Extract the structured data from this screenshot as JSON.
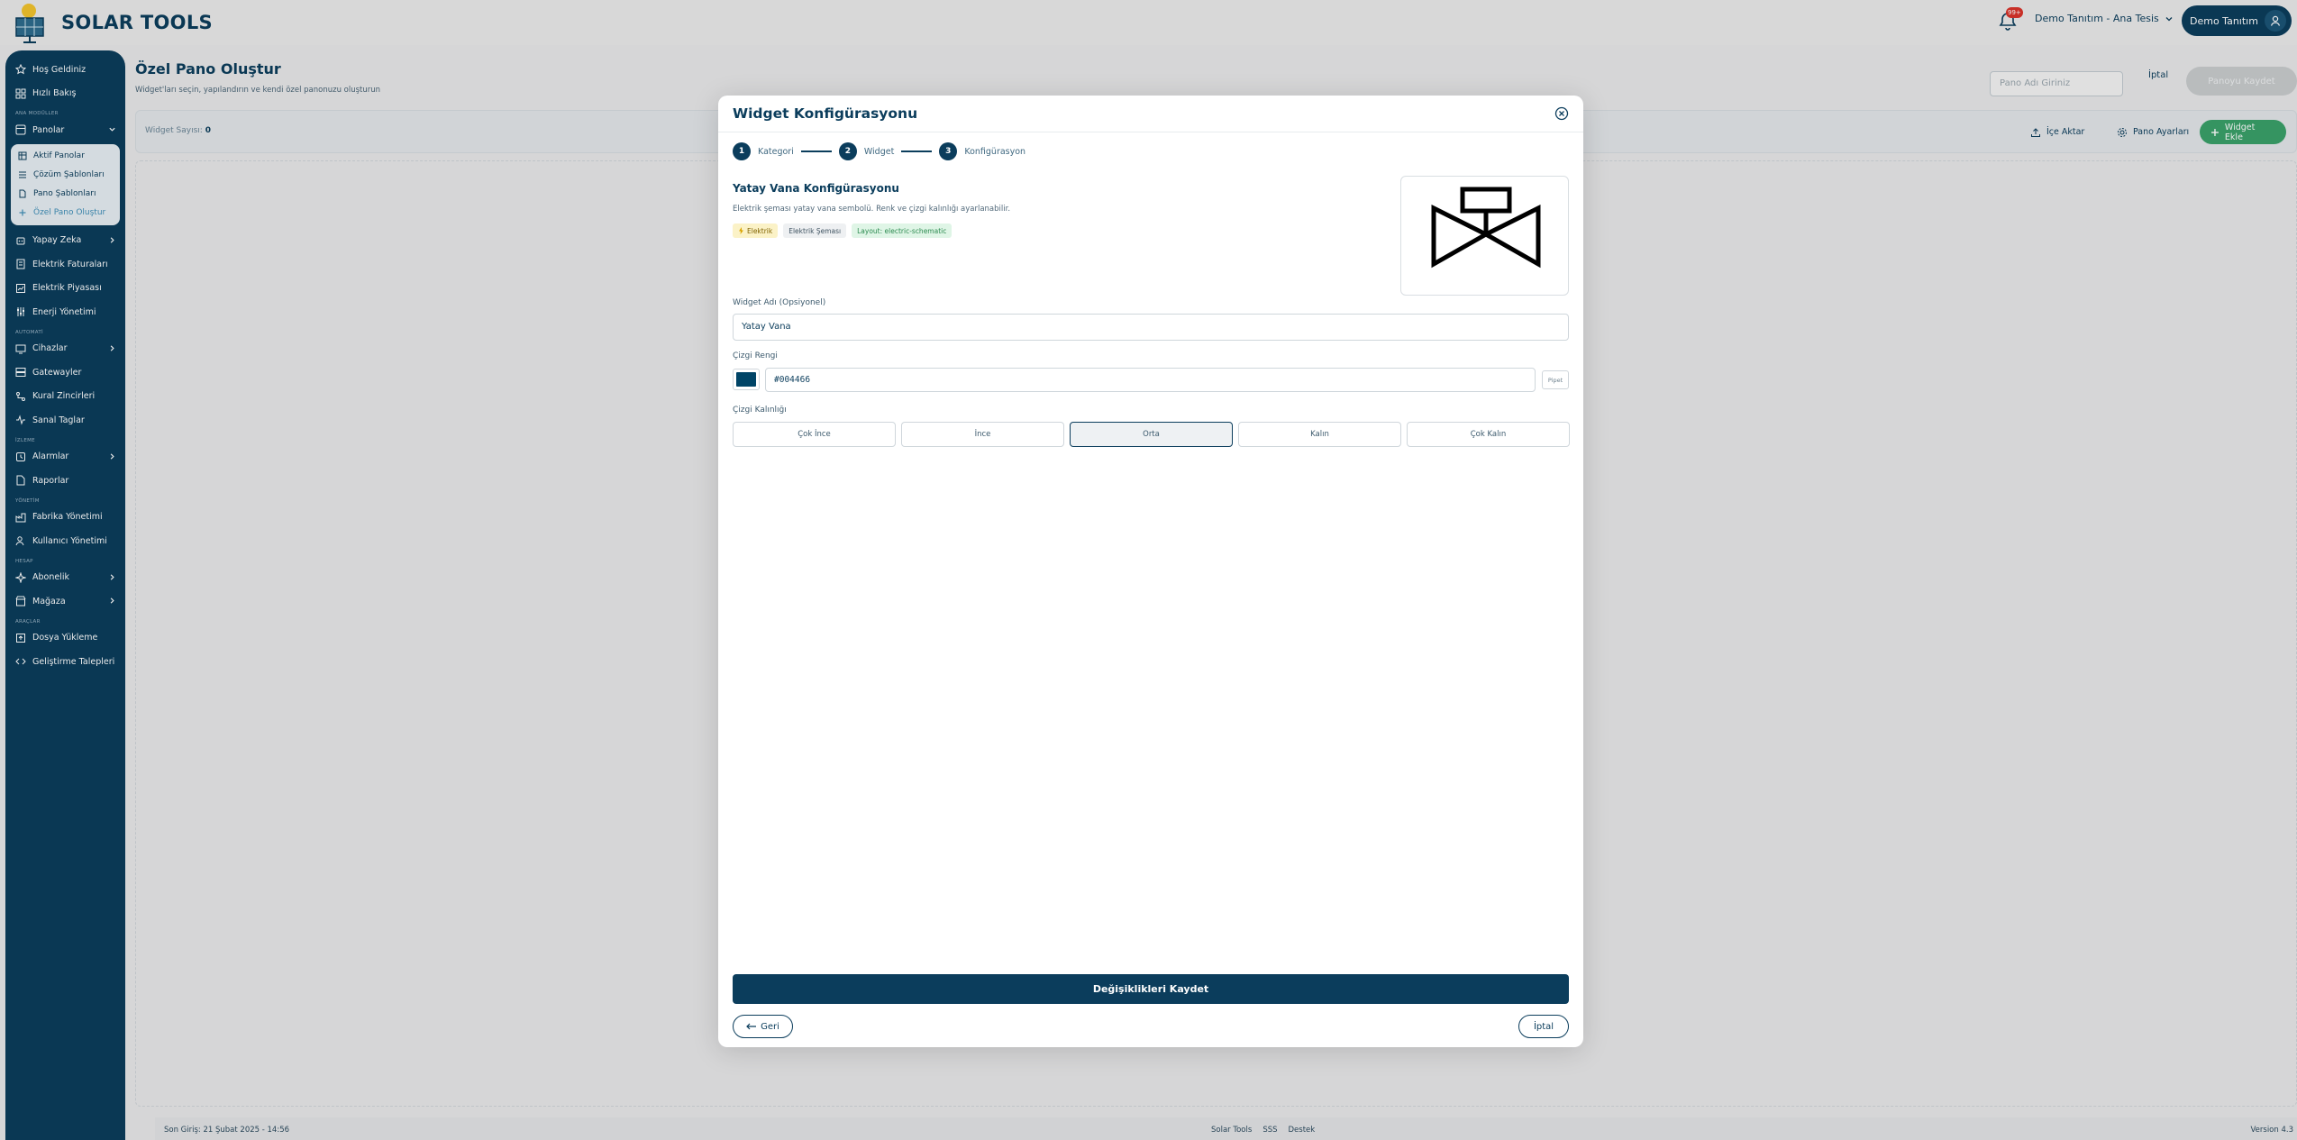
{
  "app": {
    "brand": "SOLAR TOOLS"
  },
  "header": {
    "notification_count": "99+",
    "facility": "Demo Tanıtım - Ana Tesis",
    "user_name": "Demo Tanıtım"
  },
  "sidebar": {
    "welcome": "Hoş Geldiniz",
    "quick_view": "Hızlı Bakış",
    "sec_main": "ANA MODÜLLER",
    "panels": "Panolar",
    "panels_sub": [
      "Aktif Panolar",
      "Çözüm Şablonları",
      "Pano Şablonları",
      "Özel Pano Oluştur"
    ],
    "ai": "Yapay Zeka",
    "invoices": "Elektrik Faturaları",
    "market": "Elektrik Piyasası",
    "energy": "Enerji Yönetimi",
    "sec_auto": "AUTOMATİ",
    "devices": "Cihazlar",
    "gateways": "Gatewayler",
    "rule_chains": "Kural Zincirleri",
    "virtual_tags": "Sanal Taglar",
    "sec_alarm": "İZLEME",
    "alarms": "Alarmlar",
    "reports": "Raporlar",
    "sec_admin": "YÖNETİM",
    "factory_mgmt": "Fabrika Yönetimi",
    "user_mgmt": "Kullanıcı Yönetimi",
    "sec_account": "HESAP",
    "subscription": "Abonelik",
    "store": "Mağaza",
    "sec_tools": "ARAÇLAR",
    "file_upload": "Dosya Yükleme",
    "dev_requests": "Geliştirme Talepleri"
  },
  "page": {
    "title": "Özel Pano Oluştur",
    "subtitle": "Widget'ları seçin, yapılandırın ve kendi özel panonuzu oluşturun",
    "board_name_placeholder": "Pano Adı Giriniz",
    "cancel": "İptal",
    "save": "Panoyu Kaydet",
    "widget_count_label": "Widget Sayısı:",
    "widget_count": "0",
    "import": "İçe Aktar",
    "board_settings": "Pano Ayarları",
    "add_widget": "Widget Ekle"
  },
  "modal": {
    "title": "Widget Konfigürasyonu",
    "steps": [
      {
        "num": "1",
        "label": "Kategori"
      },
      {
        "num": "2",
        "label": "Widget"
      },
      {
        "num": "3",
        "label": "Konfigürasyon"
      }
    ],
    "cfg_title": "Yatay Vana Konfigürasyonu",
    "cfg_desc": "Elektrik şeması yatay vana sembolü. Renk ve çizgi kalınlığı ayarlanabilir.",
    "chips": [
      "Elektrik",
      "Elektrik Şeması",
      "Layout: electric-schematic"
    ],
    "name_label": "Widget Adı (Opsiyonel)",
    "name_value": "Yatay Vana",
    "color_label": "Çizgi Rengi",
    "color_value": "#004466",
    "pick_label": "Pipet",
    "thickness_label": "Çizgi Kalınlığı",
    "thickness_options": [
      "Çok İnce",
      "İnce",
      "Orta",
      "Kalın",
      "Çok Kalın"
    ],
    "thickness_selected": "Orta",
    "save_changes": "Değişiklikleri Kaydet",
    "back": "Geri",
    "cancel": "İptal"
  },
  "footer": {
    "last_login": "Son Giriş: 21 Şubat 2025 - 14:56",
    "links": [
      "Solar Tools",
      "SSS",
      "Destek"
    ],
    "version": "Version 4.3"
  },
  "colors": {
    "primary": "#0b3d5c",
    "accent_green": "#3aa16a",
    "line_color": "#004466"
  }
}
